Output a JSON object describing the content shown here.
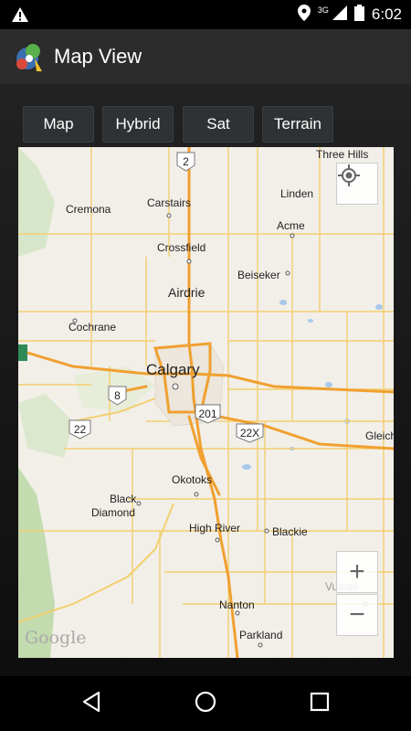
{
  "status_bar": {
    "time": "6:02",
    "network": "3G",
    "icons": [
      "warning-icon",
      "location-icon",
      "signal-icon",
      "battery-icon"
    ]
  },
  "app": {
    "title": "Map View",
    "logo": "app-logo-icon"
  },
  "map_type_buttons": [
    {
      "label": "Map"
    },
    {
      "label": "Hybrid"
    },
    {
      "label": "Sat"
    },
    {
      "label": "Terrain"
    }
  ],
  "map": {
    "places": {
      "three_hills": "Three Hills",
      "linden": "Linden",
      "cremona": "Cremona",
      "carstairs": "Carstairs",
      "acme": "Acme",
      "crossfield": "Crossfield",
      "beiseker": "Beiseker",
      "airdrie": "Airdrie",
      "cochrane": "Cochrane",
      "calgary": "Calgary",
      "gleich": "Gleich",
      "okotoks": "Okotoks",
      "black_diamond_1": "Black",
      "black_diamond_2": "Diamond",
      "high_river": "High River",
      "blackie": "Blackie",
      "vulcan": "Vulcan",
      "nanton": "Nanton",
      "parkland": "Parkland"
    },
    "highways": {
      "h2": "2",
      "h8": "8",
      "h22": "22",
      "h201": "201",
      "h22x": "22X"
    },
    "attribution": "Google",
    "controls": {
      "locate": "my-location-icon",
      "zoom_in": "+",
      "zoom_out": "−"
    }
  },
  "nav_bar": [
    "back-icon",
    "home-icon",
    "recents-icon"
  ],
  "colors": {
    "action_bar": "#2c2c2c",
    "button": "#2f3234",
    "road_major": "#f0a030",
    "road_minor": "#f3cf6e",
    "map_bg": "#f2efe9"
  }
}
